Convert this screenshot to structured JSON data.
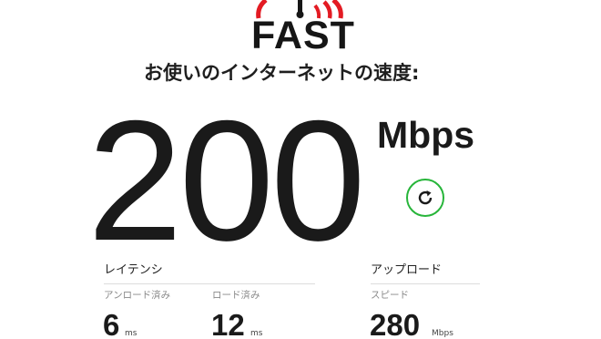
{
  "logo": {
    "text": "FAST",
    "accent_color": "#e31b23"
  },
  "heading": "お使いのインターネットの速度:",
  "speed": {
    "value": "200",
    "units": "Mbps"
  },
  "refresh": {
    "icon": "refresh-icon",
    "color": "#27b53a"
  },
  "latency": {
    "title": "レイテンシ",
    "unloaded": {
      "label": "アンロード済み",
      "value": "6",
      "unit": "ms"
    },
    "loaded": {
      "label": "ロード済み",
      "value": "12",
      "unit": "ms"
    }
  },
  "upload": {
    "title": "アップロード",
    "speed": {
      "label": "スピード",
      "value": "280",
      "unit": "Mbps"
    }
  }
}
